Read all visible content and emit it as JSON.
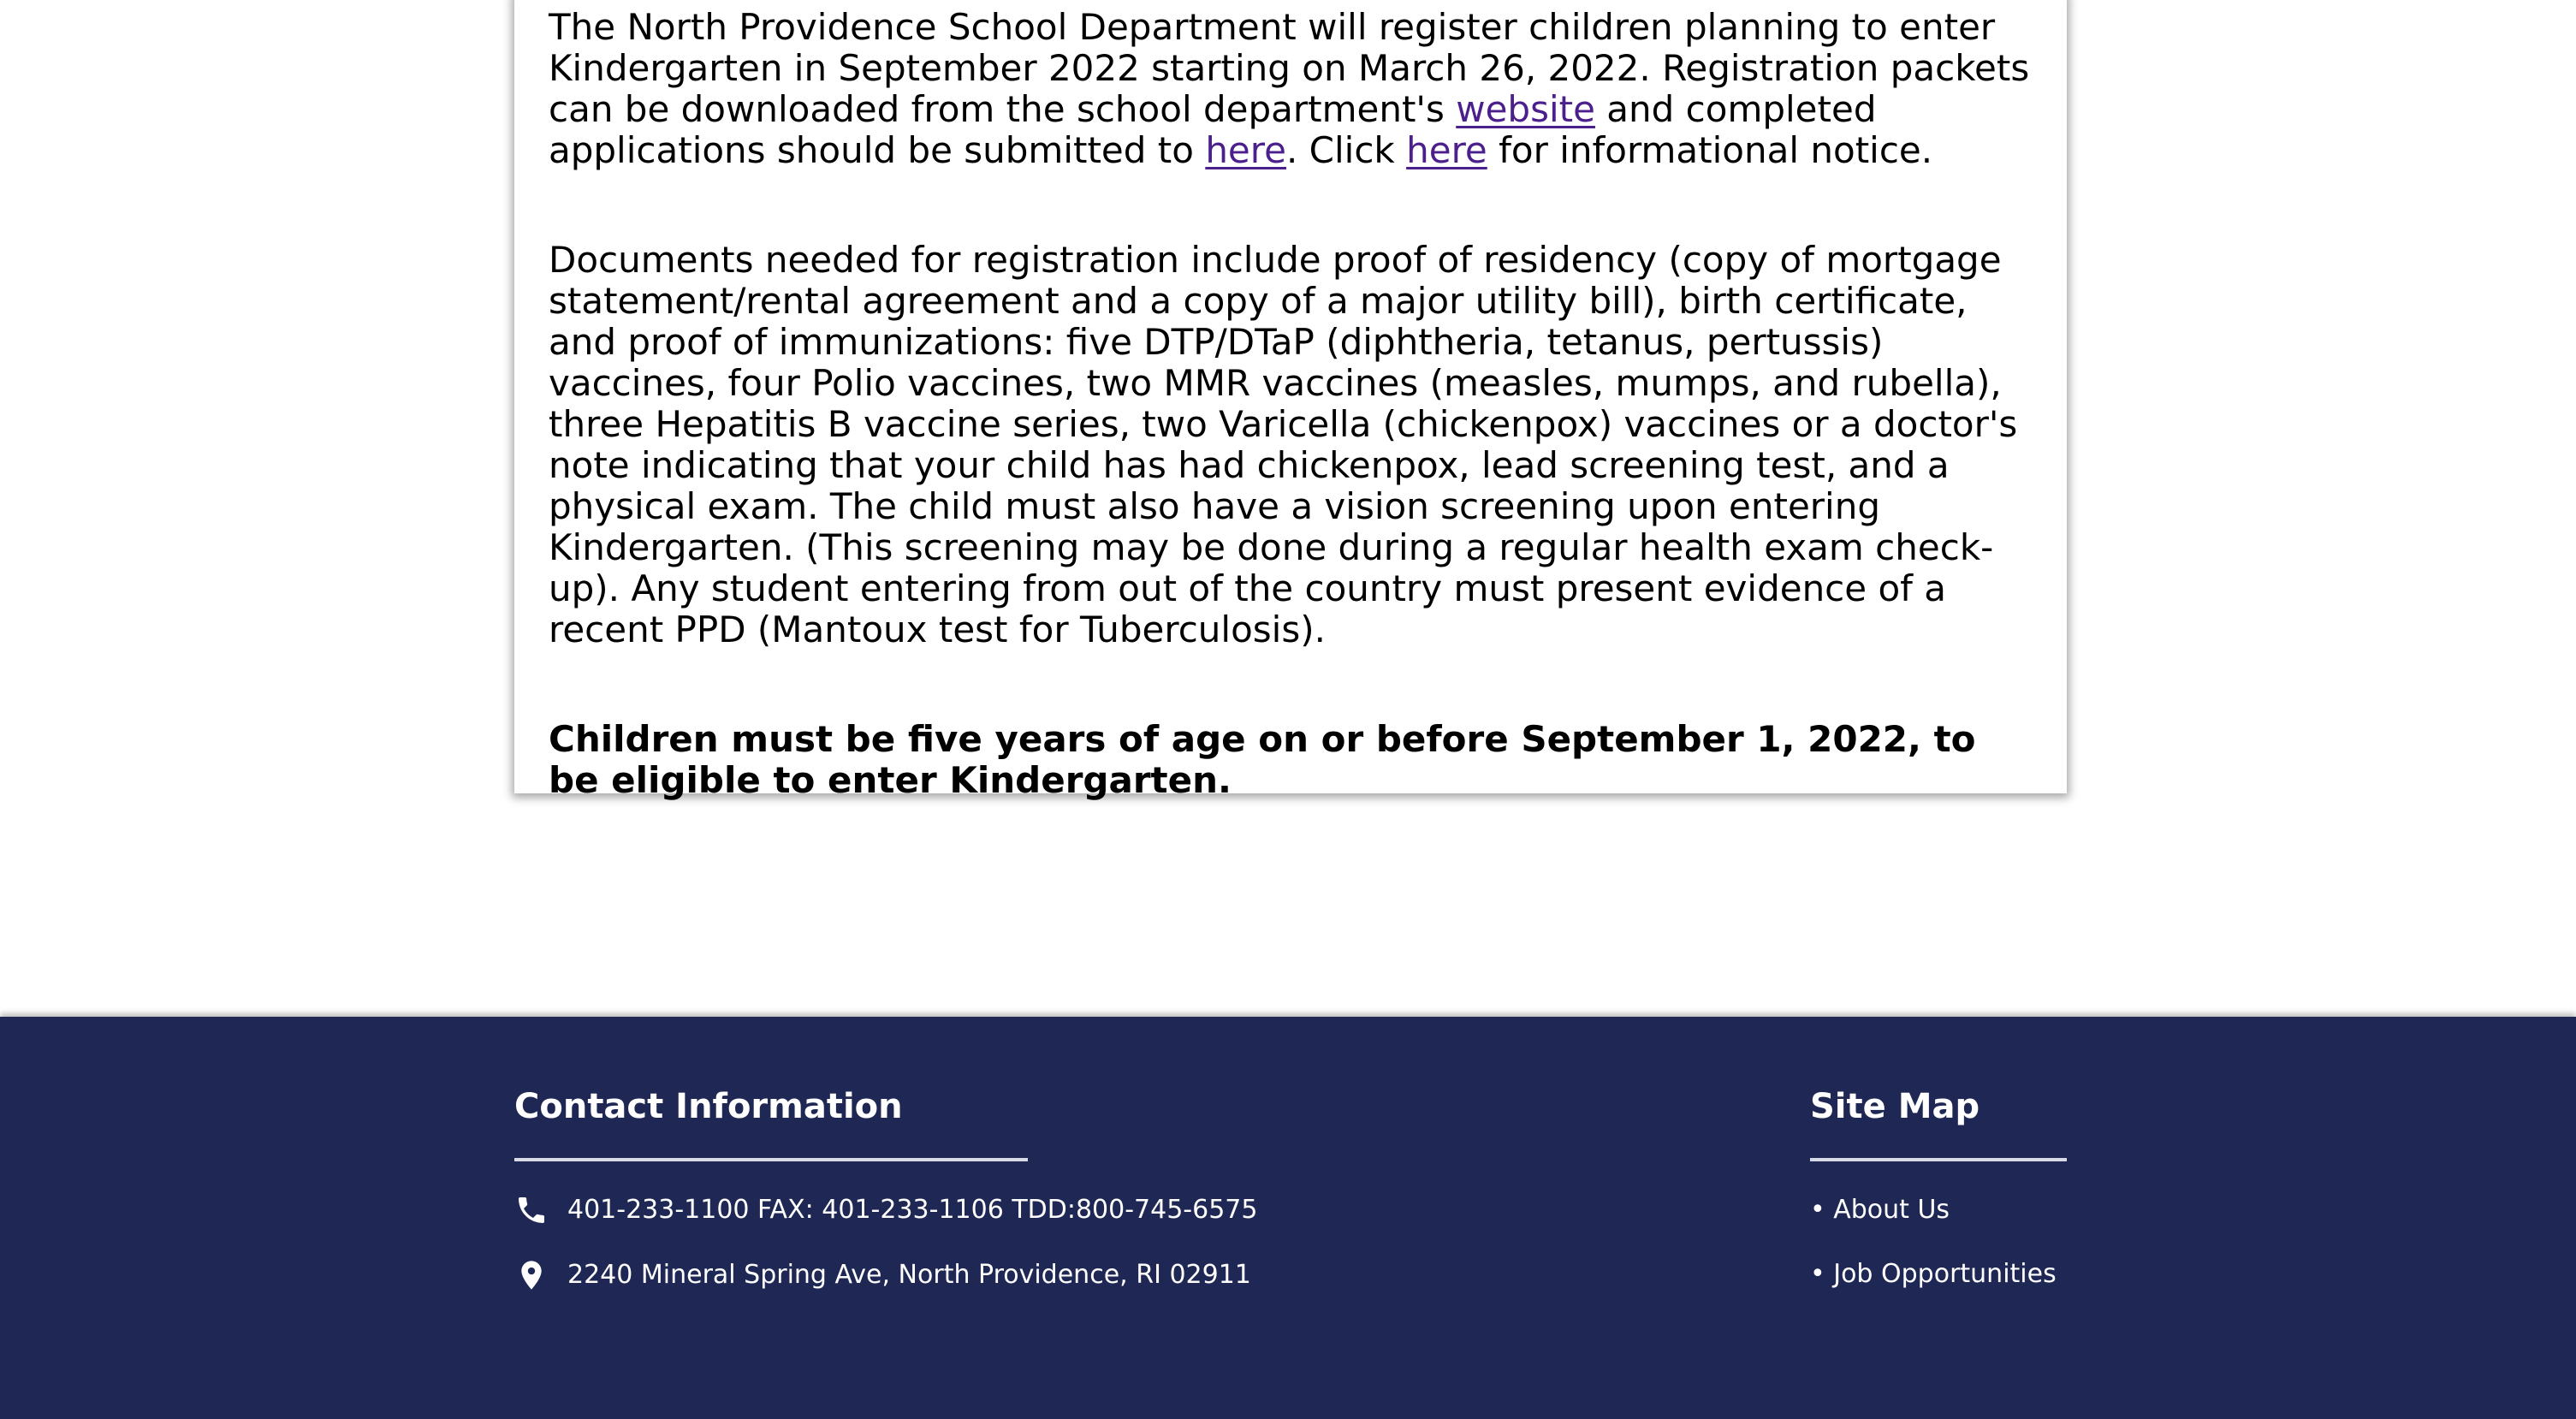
{
  "main": {
    "para1": {
      "text_1": "The North Providence School Department will register children planning to enter Kindergarten in September 2022 starting on March 26, 2022. Registration packets can be downloaded from the school department's ",
      "link_website": "website",
      "text_2": " and completed applications should be submitted to ",
      "link_here_1": "here",
      "text_3": ". Click ",
      "link_here_2": "here",
      "text_4": " for informational notice."
    },
    "para2": "Documents needed for registration include proof of residency (copy of mortgage statement/rental agreement and a copy of a major utility bill), birth certificate, and proof of immunizations: five DTP/DTaP (diphtheria, tetanus, pertussis) vaccines, four Polio vaccines, two MMR vaccines (measles, mumps, and rubella), three Hepatitis B vaccine series, two Varicella (chickenpox) vaccines or a doctor's note indicating that your child has had chickenpox, lead screening test, and a physical exam. The child must also have a vision screening upon entering Kindergarten. (This screening may be done during a regular health exam check-up). Any student entering from out of the country must present evidence of a recent PPD (Mantoux test for Tuberculosis).",
    "para3": "Children must be five years of age on or before September 1, 2022, to be eligible to enter Kindergarten."
  },
  "footer": {
    "contact": {
      "heading": "Contact Information",
      "phone_icon": "phone-icon",
      "phone_text": "401-233-1100 FAX: 401-233-1106 TDD:800-745-6575",
      "location_icon": "location-pin-icon",
      "address_text": "2240 Mineral Spring Ave, North Providence, RI 02911"
    },
    "sitemap": {
      "heading": "Site Map",
      "links": [
        "• About Us",
        "• Job Opportunities"
      ]
    }
  },
  "colors": {
    "footer_bg": "#1f2854",
    "link_visited": "#4b1f8c",
    "text": "#000000",
    "footer_text": "#ffffff"
  }
}
